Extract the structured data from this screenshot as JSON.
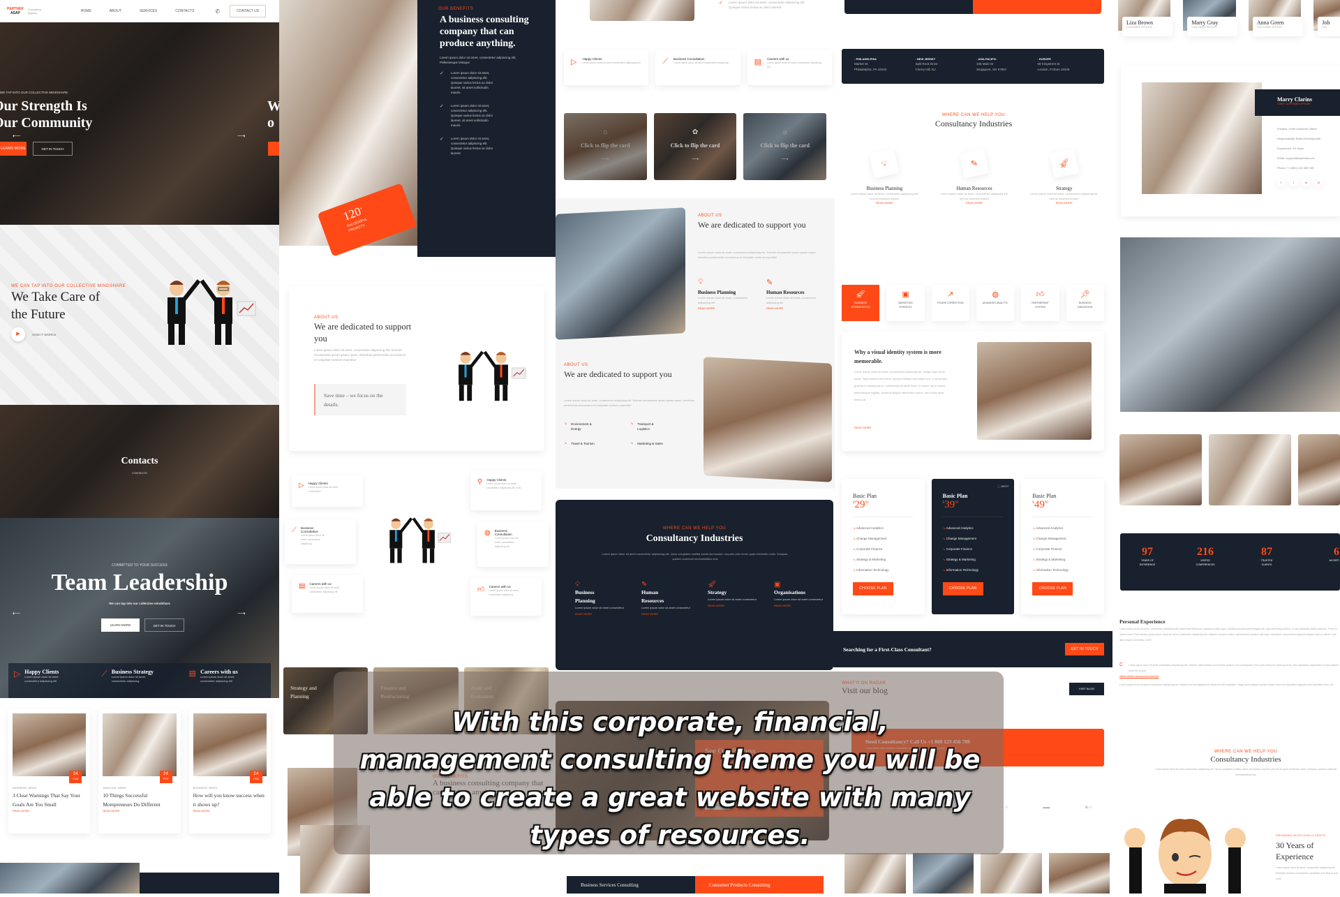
{
  "banner": {
    "caption": "With this corporate, financial, management consulting theme you will be able to create a great website with many types of resources."
  },
  "hero": {
    "logo_top": "PARTNER",
    "logo_bottom": "ASAP",
    "logo_tagline": "Consulting Agency",
    "nav": [
      "HOME",
      "ABOUT",
      "SERVICES",
      "CONTACTS"
    ],
    "contact_button": "CONTACT US",
    "kicker": "WE TAP INTO OUR COLLECTIVE MINDSHARE",
    "title_line1": "Our Strength Is",
    "title_line2": "Our Community",
    "learn_more": "LEARN MORE",
    "get_in_touch": "GET IN TOUCH",
    "next_title": "W o"
  },
  "future": {
    "kicker": "WE CAN TAP INTO OUR COLLECTIVE MINDSHARE",
    "title_line1": "We Take Care of",
    "title_line2": "the Future",
    "how_it_works": "HOW IT WORKS"
  },
  "contacts_hero": {
    "title": "Contacts",
    "breadcrumb": "CONTACTS"
  },
  "leadership": {
    "kicker": "COMMITTED TO YOUR SUCCESS",
    "title": "Team Leadership",
    "subtitle": "We can tap into our collective mindshare",
    "learn_more": "LEARN MORE",
    "get_in_touch": "GET IN TOUCH",
    "features": [
      {
        "title": "Happy Clients",
        "text": "Lorem ipsum dolor sit amet consectetur adipiscing elit"
      },
      {
        "title": "Business Strategy",
        "text": "Lorem ipsum dolor sit amet, consectetur adipiscing"
      },
      {
        "title": "Careers with us",
        "text": "Lorem ipsum dolor sit amet, consectetur adipiscing elit"
      }
    ]
  },
  "blog_cards": [
    {
      "category": "BUSINESS, NEWS",
      "day": "24",
      "month": "FEB",
      "title": "3 Clear Warnings That Say Your Goals Are Too Small",
      "link": "READ MORE"
    },
    {
      "category": "ANALYSIS, NEWS",
      "day": "24",
      "month": "FEB",
      "title": "10 Things Successful Mompreneurs Do Different",
      "link": "READ MORE"
    },
    {
      "category": "BUSINESS, NEWS",
      "day": "24",
      "month": "FEB",
      "title": "How will you know success when it shows up?",
      "link": "READ MORE"
    }
  ],
  "business_company": {
    "kicker": "OUR BENEFITS",
    "title": "A business consulting company that can produce anything.",
    "intro": "Lorem ipsum dolor sit amet, consectetur adipiscing elit. Pellentesque tristique",
    "checks": [
      "Lorem ipsum dolor sit amet, consectetur adipiscing elit. Quisque varius lectus ac dolor laoreet, sit amet sollicitudin mauris.",
      "Lorem ipsum dolor sit amet, consectetur adipiscing elit. Quisque varius lectus ac dolor laoreet, sit amet sollicitudin mauris.",
      "Lorem ipsum dolor sit amet, consectetur adipiscing elit. Quisque varius lectus ac dolor laoreet."
    ],
    "counter_value": "120",
    "counter_suffix": "+",
    "counter_label": "SUCCESSFUL PROJECTS"
  },
  "dedicated_card": {
    "kicker": "ABOUT US",
    "title": "We are dedicated to support you",
    "text": "Lorem ipsum dolor sit amet, consectetur adipiscing elit. Eveniet recusandae ipsum ipsam quam, doloribus perferendis accusamus et voluptate nostrum expedita!",
    "quote": "Save time – we focus on the details."
  },
  "feature_grid": {
    "left": [
      {
        "title": "Happy Clients",
        "text": "Lorem ipsum dolor sit amet, consectetur"
      },
      {
        "title": "Business Consultation",
        "text": "Lorem ipsum dolor sit amet, consectetur adipiscing"
      },
      {
        "title": "Careers with us",
        "text": "Lorem ipsum dolor sit amet, consectetur adipiscing elit"
      }
    ],
    "right": [
      {
        "title": "Happy Clients",
        "text": "Lorem ipsum dolor sit amet, consectetur adipiscing elit. Duis"
      },
      {
        "title": "Business Consultation",
        "text": "Lorem ipsum dolor sit amet, consectetur adipiscing elit"
      },
      {
        "title": "Careers with us",
        "text": "Lorem ipsum dolor sit amet, consectetur adipiscing"
      }
    ]
  },
  "top_middle": {
    "check_text": "Lorem ipsum dolor sit amet, consectetur adipiscing elit. Quisque varius lectus ac dolor laoreet.",
    "features": [
      {
        "title": "Happy Clients",
        "text": "Lorem ipsum dolor sit amet consectetur adipiscing elit"
      },
      {
        "title": "Business Consultation",
        "text": "Lorem ipsum dolor, sit amet consectetur adipiscing"
      },
      {
        "title": "Careers with us",
        "text": "Lorem ipsum dolor sit amet consectetur adipiscing elit"
      }
    ],
    "flip_cards": [
      "Click to flip the card",
      "Click to flip the card",
      "Click to flip the card"
    ]
  },
  "about_sections": {
    "first": {
      "kicker": "ABOUT US",
      "title": "We are dedicated to support you",
      "text": "Lorem ipsum dolor sit amet, consectetur adipiscing elit. Eveniet recusandae ipsum ipsam quam, doloribus perferendis accusamus et voluptate nostrum expedita!",
      "items": [
        {
          "title": "Business Planning",
          "text": "Lorem ipsum dolor sit amet, consectetur adipiscing elit",
          "link": "READ MORE"
        },
        {
          "title": "Human Resources",
          "text": "Lorem ipsum dolor sit amet, consectetur adipiscing elit",
          "link": "READ MORE"
        }
      ]
    },
    "second": {
      "kicker": "ABOUT US",
      "title": "We are dedicated to support you",
      "text": "Lorem ipsum dolor sit amet, consectetur adipiscing elit. Eveniet recusandae ipsum ipsam quam, doloribus perferendis accusamus et voluptate nostrum expedita!",
      "list": [
        "Environment & Energy",
        "Transport & Logistics",
        "Travel & Tourism",
        "Marketing & Sales"
      ]
    }
  },
  "dark_industries": {
    "kicker": "WHERE CAN WE HELP YOU",
    "title": "Consultancy Industries",
    "text": "Lorem ipsum dolor sit amet consectetur adipisicing elit. Quos voluptates mollitia soluta sed laudan, corporis odio rerum quas reiciendis nobis. Voluptas, quidem commodi necessitatibus eius",
    "items": [
      {
        "title": "Business Planning",
        "text": "Lorem ipsum dolor sit amet consectetur",
        "link": "READ MORE"
      },
      {
        "title": "Human Resources",
        "text": "Lorem ipsum dolor sit amet consectetur",
        "link": "READ MORE"
      },
      {
        "title": "Strategy",
        "text": "Lorem ipsum dolor sit amet consectetur",
        "link": "READ MORE"
      },
      {
        "title": "Organisations",
        "text": "Lorem ipsum dolor sit amet consectetur",
        "link": "READ MORE"
      }
    ]
  },
  "service_tiles": [
    {
      "title": "Strategy and Planning"
    },
    {
      "title": "Finance and Restructuring"
    },
    {
      "title": "Audit and Evaluation"
    }
  ],
  "process": {
    "title": "See Our Process",
    "button": "LEARN MORE"
  },
  "lower_business": {
    "kicker": "OUR BENEFITS",
    "title": "A business consulting company that can produce anything."
  },
  "consulting_tabs": {
    "left": "Business Services Consulting",
    "right": "Consumer Products Consulting"
  },
  "offices": [
    {
      "region": "PHILADELPHIA",
      "line1": "Market St.",
      "line2": "Philadelphia, PA 19103"
    },
    {
      "region": "NEW JERSEY",
      "line1": "Split Rock Drive",
      "line2": "Cherry Hill, NJ"
    },
    {
      "region": "ASIA PACIFIC",
      "line1": "345 Main St",
      "line2": "Singapore, SG 67867"
    },
    {
      "region": "EUROPE",
      "line1": "69 Kingstreet St",
      "line2": "London, P.Obox 19100"
    }
  ],
  "industries_light": {
    "kicker": "WHERE CAN WE HELP YOU",
    "title": "Consultancy Industries",
    "items": [
      {
        "title": "Business Planning",
        "text": "Lorem ipsum dolor sit amet, consectetur adipiscing elit, sed do eiusmod tempor",
        "link": "READ MORE"
      },
      {
        "title": "Human Resources",
        "text": "Lorem ipsum dolor sit amet, consectetur adipiscing elit, sed do eiusmod tempor",
        "link": "READ MORE"
      },
      {
        "title": "Strategy",
        "text": "Lorem ipsum dolor sit amet, consectetur adipiscing elit, sed do eiusmod tempor",
        "link": "READ MORE"
      }
    ]
  },
  "service_tabs": {
    "tabs": [
      "BUSINESS CONSULTATION",
      "MARKETING STRATEGY",
      "FIGURE CORRECTION",
      "ADVANCED ANALYTIC",
      "PARTNERSHIP SYSTEM",
      "BUSINESS INNOVATION"
    ],
    "active": 0,
    "panel_title": "Why a visual identity system is more memorable.",
    "panel_text": "Lorem ipsum dolor sit amet, consectetur adipiscing elit. Integer eget tortor turpis. Nam pretium elit lectus, semper facilisis nisl mattis non. In lacus felis, gravida id consequat eu, scelerisque sit amet dolor. In auctor dui in metus pellentesque sagittis. Vivamus aliquet elementum purus, nec mollis dolor finibus at.",
    "panel_link": "READ MORE"
  },
  "pricing": [
    {
      "name": "Basic Plan",
      "currency": "$",
      "price": "29",
      "cents": "99",
      "features": [
        "Advanced Analytics",
        "Change Management",
        "Corporate Finance",
        "Strategy & Marketing",
        "Information Technology"
      ],
      "button": "CHOOSE PLAN",
      "featured": false
    },
    {
      "name": "Basic Plan",
      "currency": "$",
      "price": "39",
      "cents": "99",
      "badge": "BEST",
      "features": [
        "Advanced Analytics",
        "Change Management",
        "Corporate Finance",
        "Strategy & Marketing",
        "Information Technology"
      ],
      "button": "CHOOSE PLAN",
      "featured": true
    },
    {
      "name": "Basic Plan",
      "currency": "$",
      "price": "49",
      "cents": "99",
      "features": [
        "Advanced Analytics",
        "Change Management",
        "Corporate Finance",
        "Strategy & Marketing",
        "Information Technology"
      ],
      "button": "CHOOSE PLAN",
      "featured": false
    }
  ],
  "cta": {
    "text": "Searching for a First-Class Consultant?",
    "button": "GET IN TOUCH"
  },
  "blog_section": {
    "kicker": "WHAT'S ON RADAR",
    "title": "Visit our blog",
    "button": "VISIT BLOG"
  },
  "call_banner": {
    "title": "Need Consultancy? Call Us +1 800 123 456 789",
    "text": "Lorem ipsum dolor sit amet consectetur adipiscing elit. Earum nobis totam molestiae"
  },
  "team": [
    {
      "name": "Liza Brown",
      "role": "CUSTOMER OFFICER"
    },
    {
      "name": "Marry Gray",
      "role": "CUSTOMER OFFICER"
    },
    {
      "name": "Anna Green",
      "role": "CUSTOMER OFFICER"
    },
    {
      "name": "Joh",
      "role": "CUS"
    }
  ],
  "profile": {
    "name": "Marry Clarins",
    "role": "CHIEF CUSTOMER OFFICER",
    "details": [
      "Position: Chief Customer Officer",
      "Responsibility: Brand Development",
      "Experience: 15 Years",
      "Email: support@mybrand.com",
      "Phone: +1 (800) 123 456 789"
    ],
    "socials": [
      "facebook",
      "twitter",
      "linkedin",
      "instagram"
    ]
  },
  "stats": [
    {
      "value": "97",
      "label": "YEARS OF EXPERIENCE"
    },
    {
      "value": "216",
      "label": "VISITED CONFERENCES"
    },
    {
      "value": "87",
      "label": "TRUSTED CLIENTS"
    },
    {
      "value": "6",
      "label": "MI CERT"
    }
  ],
  "personal": {
    "title": "Personal Experience",
    "text": "Lorem ipsum dolor sit amet, consectetur adipiscing elit. Maecenas felis lacus, gravida at justo eget, convallis tincidunt amet feugiat nisi, eget scelerisque libero. In hac habitasse platea dictumst. Proin eu viverra urna. Proin tempus quam ipsum dolor sit, amet consectetur adipisicing elit. Maxime vel animi natus, reprehenderit quidem odit fugit, voluptatum accusantium quaerat adipisci iusto ut labore? Iure illum eaque aut tenetur, unde!",
    "quote": "Lorem ipsum dolor sit amet consectetur adipisicing elit. Dolores ullam beatae sunt tenetur quidem non consequatur. Eum porro tempore nobis quod hic, sed voluptatem aspernatur et eum adipisci quasi illo at sunt.",
    "link_text": "officiis tenetur assumenda reiciendis",
    "text2": "Lorem ipsum dolor sit amet consectetur adipisicing elit. Incidunt eveniet dignissimos deserunt nihil explicabo. Magni quod adipisci quidem autem enim ad voluptatem aliquam eum blanditiis! Nam, vel."
  },
  "industries_light2": {
    "kicker": "WHERE CAN WE HELP YOU",
    "title": "Consultancy Industries",
    "text": "Lorem ipsum dolor sit amet consectetur adipisicing elit. Quos voluptates mollitia soluta sed laudan corporis odio rerum quas reiciendis nobis. Voluptas, quidem commodi necessitatibus eius"
  },
  "experience": {
    "kicker": "GROWING WITH OUR CLIENTS",
    "title_line1": "30 Years of",
    "title_line2": "Experience",
    "text": "Lorem ipsum dolor sit amet, consectetur adipiscing elit. Distinctio dolores consequatur cupiditate ut et aliquid cum unde."
  },
  "colors": {
    "accent": "#ff4a17",
    "dark": "#18212d"
  }
}
